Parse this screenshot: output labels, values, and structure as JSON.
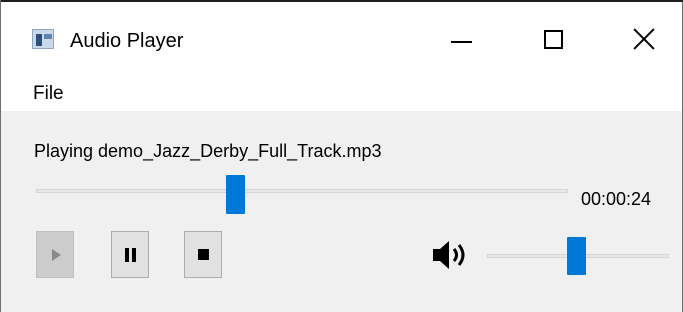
{
  "window": {
    "title": "Audio Player",
    "icons": {
      "app": "app-window-icon",
      "minimize": "minimize-icon",
      "maximize": "maximize-icon",
      "close": "close-icon"
    }
  },
  "menu": {
    "items": [
      {
        "label": "File"
      }
    ]
  },
  "player": {
    "status_text": "Playing demo_Jazz_Derby_Full_Track.mp3",
    "position_text": "00:00:24",
    "seek_fraction": 0.37,
    "volume_fraction": 0.49,
    "controls": {
      "play": {
        "icon": "play-icon",
        "enabled": false
      },
      "pause": {
        "icon": "pause-icon",
        "enabled": true
      },
      "stop": {
        "icon": "stop-icon",
        "enabled": true
      }
    },
    "volume_icon": "speaker-volume-icon"
  },
  "colors": {
    "accent": "#0078d7",
    "client_bg": "#f0f0f0",
    "button_bg": "#e1e1e1",
    "disabled_button_bg": "#cccccc"
  }
}
